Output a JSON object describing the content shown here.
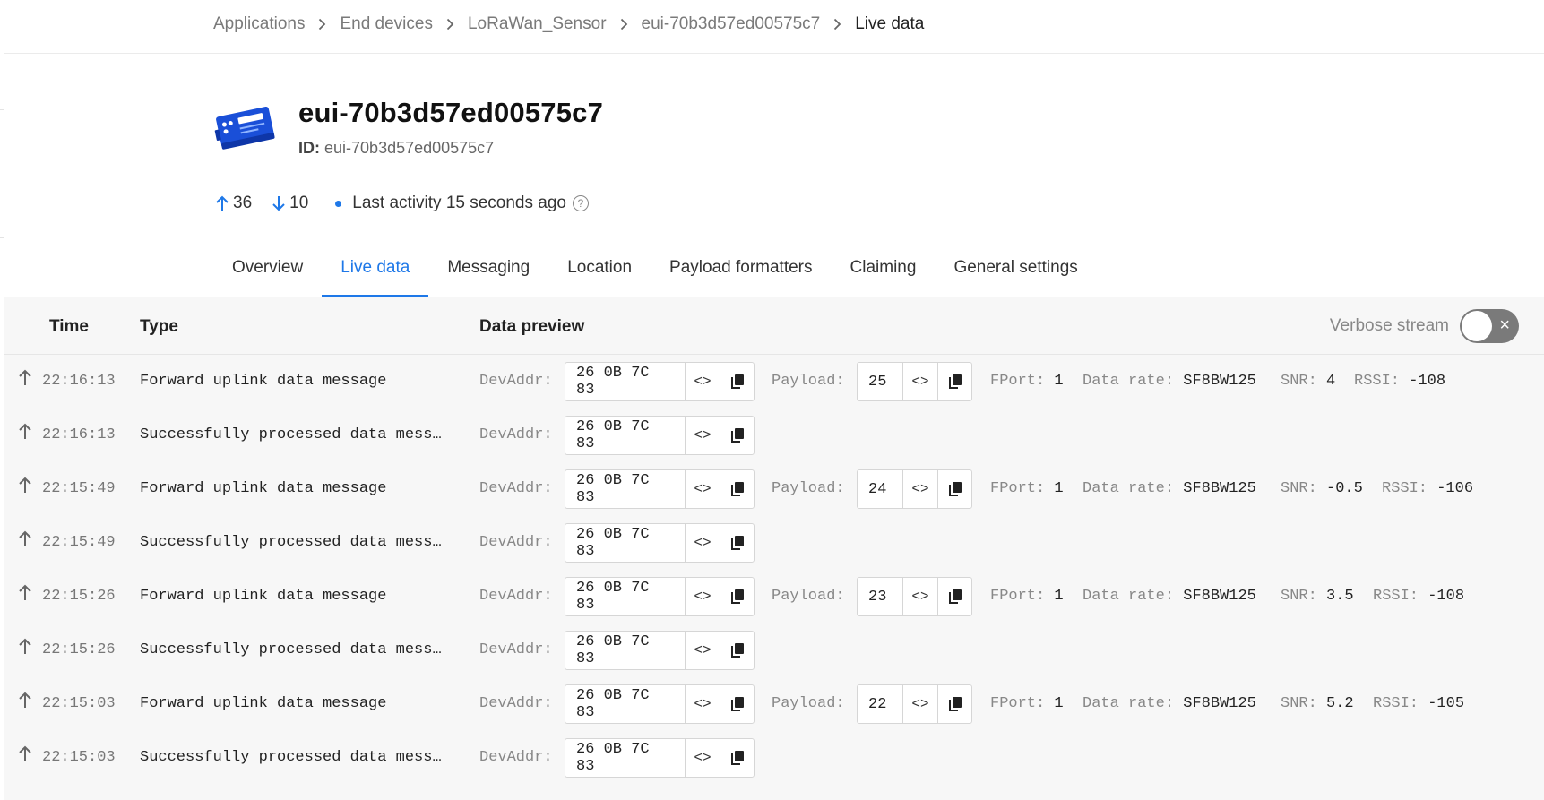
{
  "breadcrumb": {
    "items": [
      "Applications",
      "End devices",
      "LoRaWan_Sensor",
      "eui-70b3d57ed00575c7",
      "Live data"
    ]
  },
  "device": {
    "title": "eui-70b3d57ed00575c7",
    "id_label": "ID:",
    "id_value": "eui-70b3d57ed00575c7",
    "uplink_count": "36",
    "downlink_count": "10",
    "last_activity": "Last activity 15 seconds ago",
    "help_glyph": "?"
  },
  "tabs": [
    "Overview",
    "Live data",
    "Messaging",
    "Location",
    "Payload formatters",
    "Claiming",
    "General settings"
  ],
  "active_tab": "Live data",
  "table": {
    "col_time": "Time",
    "col_type": "Type",
    "col_preview": "Data preview",
    "verbose_label": "Verbose stream",
    "verbose_toggle_glyph": "×",
    "devaddr_label": "DevAddr:",
    "payload_label": "Payload:",
    "fport_label": "FPort:",
    "datarate_label": "Data rate:",
    "snr_label": "SNR:",
    "rssi_label": "RSSI:",
    "code_glyph": "<>",
    "rows": [
      {
        "time": "22:16:13",
        "type": "Forward uplink data message",
        "devaddr": "26 0B 7C 83",
        "payload": "25",
        "fport": "1",
        "datarate": "SF8BW125",
        "snr": "4",
        "rssi": "-108"
      },
      {
        "time": "22:16:13",
        "type": "Successfully processed data mess…",
        "devaddr": "26 0B 7C 83"
      },
      {
        "time": "22:15:49",
        "type": "Forward uplink data message",
        "devaddr": "26 0B 7C 83",
        "payload": "24",
        "fport": "1",
        "datarate": "SF8BW125",
        "snr": "-0.5",
        "rssi": "-106"
      },
      {
        "time": "22:15:49",
        "type": "Successfully processed data mess…",
        "devaddr": "26 0B 7C 83"
      },
      {
        "time": "22:15:26",
        "type": "Forward uplink data message",
        "devaddr": "26 0B 7C 83",
        "payload": "23",
        "fport": "1",
        "datarate": "SF8BW125",
        "snr": "3.5",
        "rssi": "-108"
      },
      {
        "time": "22:15:26",
        "type": "Successfully processed data mess…",
        "devaddr": "26 0B 7C 83"
      },
      {
        "time": "22:15:03",
        "type": "Forward uplink data message",
        "devaddr": "26 0B 7C 83",
        "payload": "22",
        "fport": "1",
        "datarate": "SF8BW125",
        "snr": "5.2",
        "rssi": "-105"
      },
      {
        "time": "22:15:03",
        "type": "Successfully processed data mess…",
        "devaddr": "26 0B 7C 83"
      }
    ]
  },
  "colors": {
    "accent": "#1e78e8",
    "toggle_off": "#7a7a7a"
  }
}
